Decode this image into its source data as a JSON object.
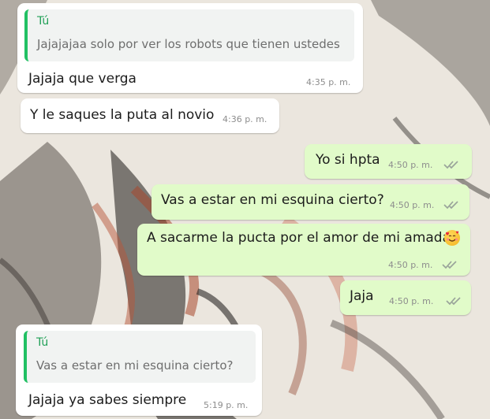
{
  "messages": [
    {
      "direction": "incoming",
      "quote": {
        "author": "Tú",
        "text": "Jajajajaa solo por ver los robots que tienen ustedes"
      },
      "text": "Jajaja que verga",
      "time": "4:35 p. m."
    },
    {
      "direction": "incoming",
      "text": "Y le saques la puta al novio",
      "time": "4:36 p. m."
    },
    {
      "direction": "outgoing",
      "text": "Yo si hpta",
      "time": "4:50 p. m.",
      "status": "read"
    },
    {
      "direction": "outgoing",
      "text": "Vas a estar en mi esquina cierto?",
      "time": "4:50 p. m.",
      "status": "read"
    },
    {
      "direction": "outgoing",
      "text": "A sacarme la pucta por el amor de mi amada",
      "emoji": "smiling-face-with-hearts",
      "time": "4:50 p. m.",
      "status": "read"
    },
    {
      "direction": "outgoing",
      "text": "Jaja",
      "time": "4:50 p. m.",
      "status": "read"
    },
    {
      "direction": "incoming",
      "quote": {
        "author": "Tú",
        "text": "Vas a estar en mi esquina cierto?"
      },
      "text": "Jajaja ya sabes siempre",
      "time": "5:19 p. m."
    }
  ],
  "colors": {
    "incoming_bubble": "#ffffff",
    "outgoing_bubble": "#e1fbc9",
    "quote_accent": "#21c063",
    "read_ticks": "#9aa49a"
  }
}
